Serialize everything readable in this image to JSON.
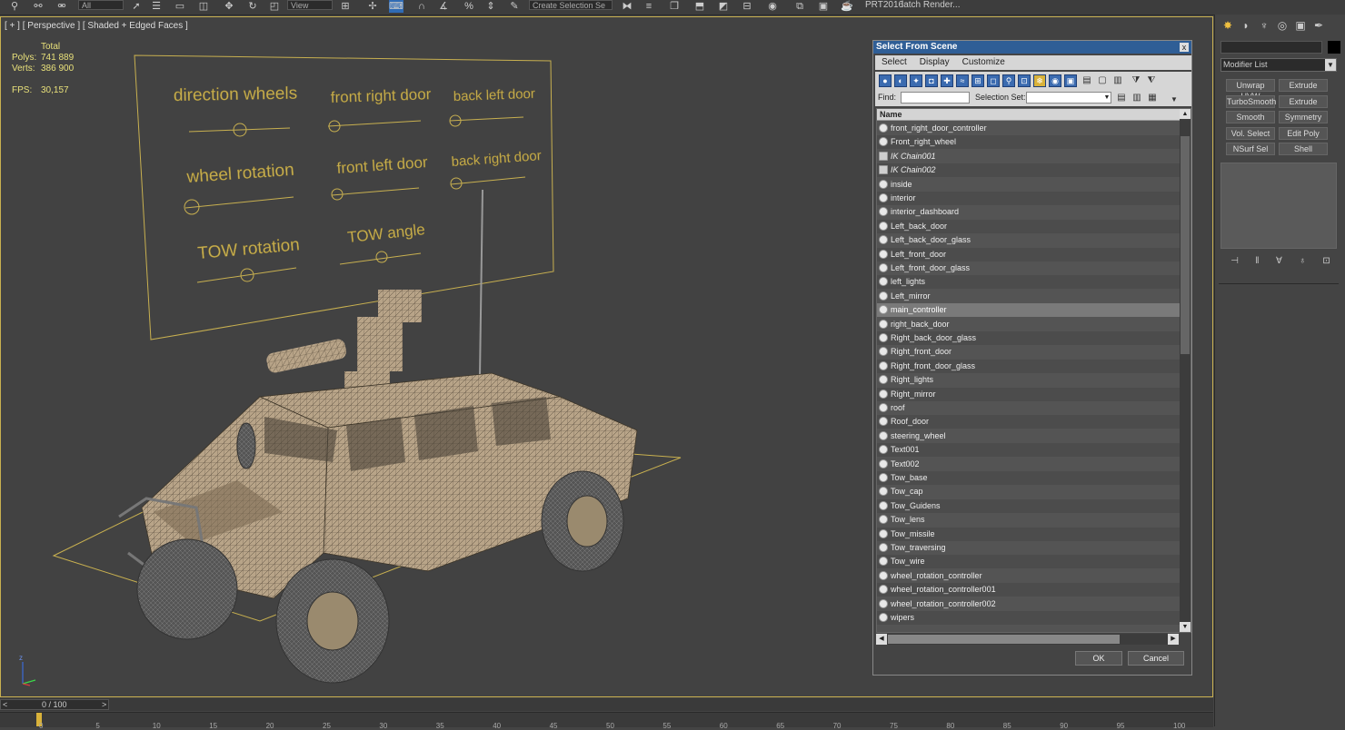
{
  "toolbar": {
    "filter_value": "All",
    "view_value": "View",
    "selection_set_placeholder": "Create Selection Se",
    "prt_label": "PRT2016",
    "batch_render_label": "latch Render..."
  },
  "viewport": {
    "label": "[ + ] [ Perspective ] [ Shaded + Edged Faces ]",
    "stats": {
      "total_label": "Total",
      "polys_label": "Polys:",
      "polys_value": "741 889",
      "verts_label": "Verts:",
      "verts_value": "386 900",
      "fps_label": "FPS:",
      "fps_value": "30,157"
    },
    "panel_labels": {
      "direction_wheels": "direction wheels",
      "front_right_door": "front right door",
      "back_left_door": "back left door",
      "wheel_rotation": "wheel rotation",
      "front_left_door": "front left door",
      "back_right_door": "back right door",
      "tow_rotation": "TOW rotation",
      "tow_angle": "TOW angle"
    },
    "axis_z": "z",
    "accent_color": "#c8b050"
  },
  "timeline": {
    "frame_text": "0 / 100",
    "prev_arrow": "<",
    "next_arrow": ">",
    "ticks": [
      "0",
      "5",
      "10",
      "15",
      "20",
      "25",
      "30",
      "35",
      "40",
      "45",
      "50",
      "55",
      "60",
      "65",
      "70",
      "75",
      "80",
      "85",
      "90",
      "95",
      "100"
    ]
  },
  "command_panel": {
    "modifier_list_label": "Modifier List",
    "buttons": [
      "Unwrap UVW",
      "Extrude",
      "TurboSmooth",
      "Extrude",
      "Smooth",
      "Symmetry",
      "Vol. Select",
      "Edit Poly",
      "NSurf Sel",
      "Shell"
    ]
  },
  "dialog": {
    "title": "Select From Scene",
    "close": "x",
    "menu": [
      "Select",
      "Display",
      "Customize"
    ],
    "find_label": "Find:",
    "selection_set_label": "Selection Set:",
    "column_name": "Name",
    "items": [
      {
        "name": "front_right_door_controller",
        "icon": "helper"
      },
      {
        "name": "Front_right_wheel",
        "icon": "geometry"
      },
      {
        "name": "IK Chain001",
        "icon": "ik",
        "italic": true
      },
      {
        "name": "IK Chain002",
        "icon": "ik",
        "italic": true
      },
      {
        "name": "inside",
        "icon": "geometry"
      },
      {
        "name": "interior",
        "icon": "geometry"
      },
      {
        "name": "interior_dashboard",
        "icon": "geometry"
      },
      {
        "name": "Left_back_door",
        "icon": "geometry"
      },
      {
        "name": "Left_back_door_glass",
        "icon": "geometry"
      },
      {
        "name": "Left_front_door",
        "icon": "geometry"
      },
      {
        "name": "Left_front_door_glass",
        "icon": "geometry"
      },
      {
        "name": "left_lights",
        "icon": "geometry"
      },
      {
        "name": "Left_mirror",
        "icon": "geometry"
      },
      {
        "name": "main_controller",
        "icon": "helper",
        "selected": true
      },
      {
        "name": "right_back_door",
        "icon": "geometry"
      },
      {
        "name": "Right_back_door_glass",
        "icon": "geometry"
      },
      {
        "name": "Right_front_door",
        "icon": "geometry"
      },
      {
        "name": "Right_front_door_glass",
        "icon": "geometry"
      },
      {
        "name": "Right_lights",
        "icon": "geometry"
      },
      {
        "name": "Right_mirror",
        "icon": "geometry"
      },
      {
        "name": "roof",
        "icon": "geometry"
      },
      {
        "name": "Roof_door",
        "icon": "geometry"
      },
      {
        "name": "steering_wheel",
        "icon": "geometry"
      },
      {
        "name": "Text001",
        "icon": "helper"
      },
      {
        "name": "Text002",
        "icon": "helper"
      },
      {
        "name": "Tow_base",
        "icon": "geometry"
      },
      {
        "name": "Tow_cap",
        "icon": "geometry"
      },
      {
        "name": "Tow_Guidens",
        "icon": "geometry"
      },
      {
        "name": "Tow_lens",
        "icon": "geometry"
      },
      {
        "name": "Tow_missile",
        "icon": "geometry"
      },
      {
        "name": "Tow_traversing",
        "icon": "geometry"
      },
      {
        "name": "Tow_wire",
        "icon": "geometry"
      },
      {
        "name": "wheel_rotation_controller",
        "icon": "helper"
      },
      {
        "name": "wheel_rotation_controller001",
        "icon": "helper"
      },
      {
        "name": "wheel_rotation_controller002",
        "icon": "helper"
      },
      {
        "name": "wipers",
        "icon": "geometry"
      }
    ],
    "ok_label": "OK",
    "cancel_label": "Cancel"
  }
}
